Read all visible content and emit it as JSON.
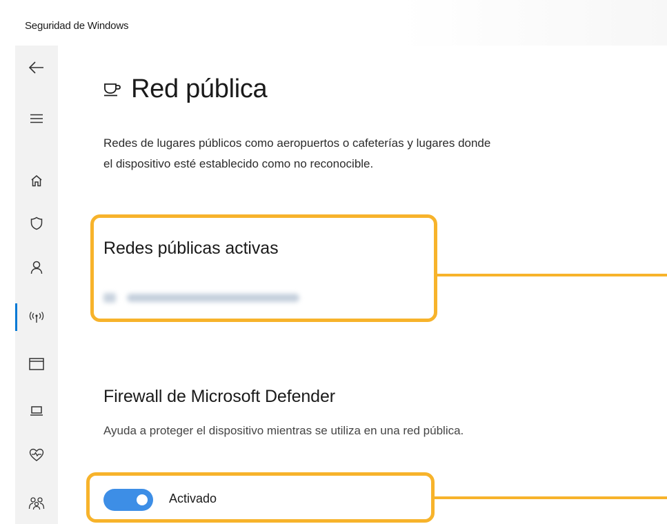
{
  "window": {
    "app_title": "Seguridad de Windows"
  },
  "sidebar": {
    "items": [
      {
        "name": "back",
        "icon": "back-arrow-icon"
      },
      {
        "name": "menu",
        "icon": "hamburger-menu-icon"
      },
      {
        "name": "home",
        "icon": "home-icon"
      },
      {
        "name": "virus-protection",
        "icon": "shield-icon"
      },
      {
        "name": "account-protection",
        "icon": "person-icon"
      },
      {
        "name": "firewall-network",
        "icon": "wireless-signal-icon",
        "selected": true
      },
      {
        "name": "app-browser-control",
        "icon": "browser-window-icon"
      },
      {
        "name": "device-security",
        "icon": "laptop-icon"
      },
      {
        "name": "device-performance",
        "icon": "heart-pulse-icon"
      },
      {
        "name": "family-options",
        "icon": "family-icon"
      }
    ],
    "accent_color": "#0078d4"
  },
  "main": {
    "page_icon": "coffee-cup-icon",
    "title": "Red pública",
    "description_line1": "Redes de lugares públicos como aeropuertos o cafeterías y lugares donde",
    "description_line2": "el dispositivo esté establecido como no reconocible.",
    "active_networks": {
      "title": "Redes públicas activas"
    },
    "firewall": {
      "title": "Firewall de Microsoft Defender",
      "description": "Ayuda a proteger el dispositivo mientras se utiliza en una red pública.",
      "toggle_state": "on",
      "toggle_label": "Activado",
      "toggle_color": "#3d8ee6"
    },
    "callout_color": "#f7b32b"
  }
}
